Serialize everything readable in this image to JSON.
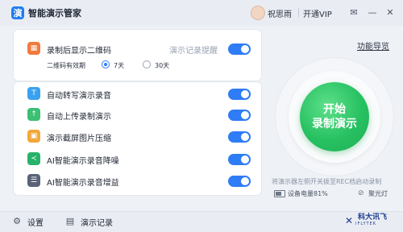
{
  "app": {
    "title": "智能演示管家",
    "logo_char": "演"
  },
  "header": {
    "user_name": "祝思雨",
    "vip_label": "开通VIP",
    "controls": [
      "✉",
      "—",
      "✕"
    ]
  },
  "settings_card": {
    "qr_option": {
      "label": "录制后显示二维码",
      "secondary": "演示记录提醒",
      "enabled": true
    },
    "validity": {
      "label": "二维码有效期",
      "options": [
        {
          "label": "7天",
          "selected": true
        },
        {
          "label": "30天",
          "selected": false
        }
      ]
    }
  },
  "features": [
    {
      "label": "自动转写演示录音",
      "enabled": true,
      "color": "#3aa1f0"
    },
    {
      "label": "自动上传录制演示",
      "enabled": true,
      "color": "#3cc073"
    },
    {
      "label": "演示截屏图片压缩",
      "enabled": true,
      "color": "#f2a93b"
    },
    {
      "label": "AI智能演示录音降噪",
      "enabled": true,
      "color": "#27b26b"
    },
    {
      "label": "AI智能演示录音增益",
      "enabled": true,
      "color": "#5a6478"
    }
  ],
  "right_panel": {
    "guide_link": "功能导览",
    "start_button": {
      "line1": "开始",
      "line2": "录制演示"
    },
    "hint": "将演示器左侧开关拨至REC档启动录制",
    "battery": "设备电量81%",
    "flash": "聚光灯"
  },
  "bottom": {
    "settings_label": "设置",
    "records_label": "演示记录",
    "brand": {
      "name": "科大讯飞",
      "sub": "IFLYTEK"
    }
  }
}
